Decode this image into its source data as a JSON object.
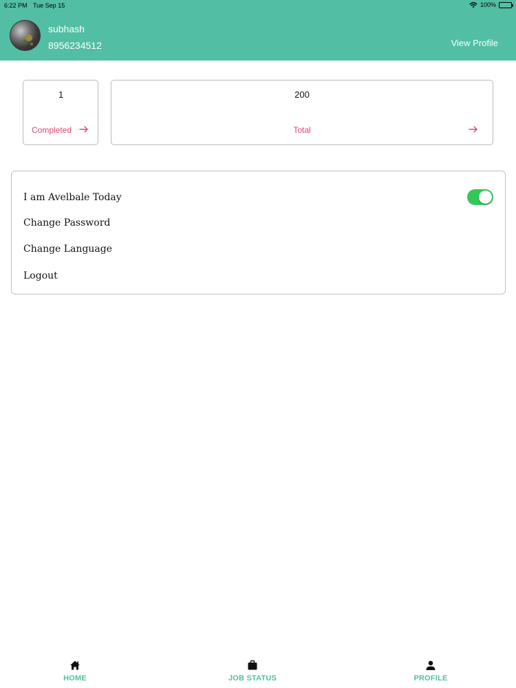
{
  "status_bar": {
    "time": "6:22 PM",
    "date": "Tue Sep 15",
    "battery": "100%"
  },
  "header": {
    "name": "subhash",
    "phone": "8956234512",
    "view_profile_label": "View Profile",
    "background_color": "#52bea3"
  },
  "stats": {
    "completed": {
      "value": "1",
      "label": "Completed"
    },
    "total": {
      "value": "200",
      "label": "Total"
    },
    "accent_color": "#e0446b"
  },
  "settings": {
    "available_label": "I am Avelbale Today",
    "available_on": true,
    "change_password_label": "Change Password",
    "change_language_label": "Change Language",
    "logout_label": "Logout",
    "toggle_color": "#34c759"
  },
  "tabbar": {
    "tabs": [
      {
        "label": "HOME",
        "icon": "home-icon"
      },
      {
        "label": "JOB STATUS",
        "icon": "briefcase-icon"
      },
      {
        "label": "PROFILE",
        "icon": "person-icon"
      }
    ],
    "active_color": "#52bea3"
  }
}
